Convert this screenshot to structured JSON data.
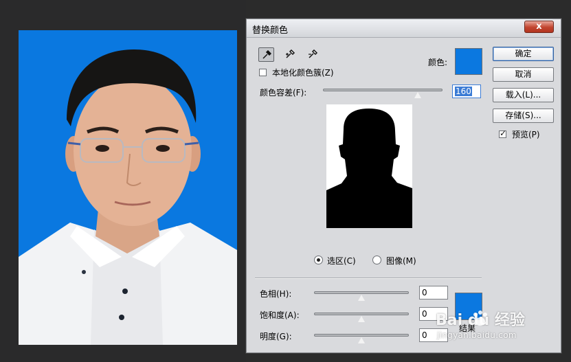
{
  "dialog": {
    "title": "替换颜色",
    "close_label": "x",
    "tools": [
      "eyedropper-tool",
      "eyedropper-plus-tool",
      "eyedropper-minus-tool"
    ],
    "localized_label": "本地化颜色簇(Z)",
    "localized_checked": false,
    "color_label": "颜色:",
    "color_value": "#0b78e0",
    "fuzziness_label": "颜色容差(F):",
    "fuzziness_value": "160",
    "fuzziness_fraction": 0.8,
    "radio_selection_label": "选区(C)",
    "radio_image_label": "图像(M)",
    "selected_radio": "selection",
    "hue_label": "色相(H):",
    "hue_value": "0",
    "saturation_label": "饱和度(A):",
    "saturation_value": "0",
    "lightness_label": "明度(G):",
    "lightness_value": "0",
    "result_label": "结果",
    "result_color": "#0b78e0",
    "buttons": {
      "ok": "确定",
      "cancel": "取消",
      "load": "载入(L)...",
      "save": "存储(S)..."
    },
    "preview_label": "预览(P)",
    "preview_checked": true
  },
  "watermark": {
    "brand": "Bai du 经验",
    "url": "jingyan.baidu.com"
  },
  "colors": {
    "photo_background": "#0a78e0",
    "dialog_background": "#d9dadd",
    "canvas_background": "#2b2b2b"
  }
}
